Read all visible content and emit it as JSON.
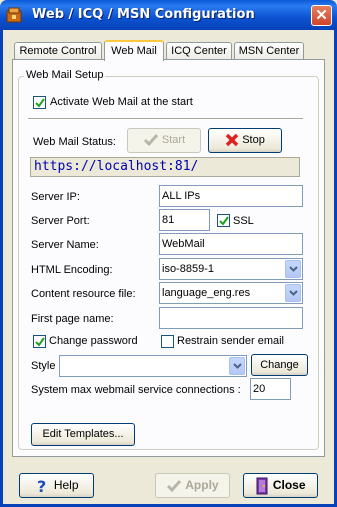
{
  "window": {
    "title": "Web / ICQ / MSN Configuration",
    "close_glyph": "✕"
  },
  "tabs": [
    {
      "label": "Remote Control",
      "active": false
    },
    {
      "label": "Web Mail",
      "active": true
    },
    {
      "label": "ICQ Center",
      "active": false
    },
    {
      "label": "MSN Center",
      "active": false
    }
  ],
  "group": {
    "title": "Web Mail Setup"
  },
  "activate": {
    "label": "Activate Web Mail at the start",
    "checked": true
  },
  "status": {
    "label": "Web Mail Status:",
    "start_label": "Start",
    "stop_label": "Stop",
    "url": "https://localhost:81/"
  },
  "fields": {
    "server_ip": {
      "label": "Server IP:",
      "value": "ALL IPs"
    },
    "server_port": {
      "label": "Server Port:",
      "value": "81"
    },
    "ssl": {
      "label": "SSL",
      "checked": true
    },
    "server_name": {
      "label": "Server Name:",
      "value": "WebMail"
    },
    "html_encoding": {
      "label": "HTML Encoding:",
      "value": "iso-8859-1"
    },
    "content_resource": {
      "label": "Content resource file:",
      "value": "language_eng.res"
    },
    "first_page": {
      "label": "First page name:",
      "value": ""
    },
    "change_password": {
      "label": "Change password",
      "checked": true
    },
    "restrain_sender": {
      "label": "Restrain sender email",
      "checked": false
    },
    "style": {
      "label": "Style",
      "value": "",
      "change_label": "Change"
    },
    "max_connections": {
      "label": "System max webmail service connections :",
      "value": "20"
    }
  },
  "edit_templates_label": "Edit Templates...",
  "footer": {
    "help_label": "Help",
    "apply_label": "Apply",
    "close_label": "Close"
  },
  "colors": {
    "titlebar": "#0842b8",
    "accent_tab": "#ffc83c",
    "stop_icon": "#e02020",
    "url_text": "#0000b0"
  },
  "icons": [
    "app-icon",
    "close-icon",
    "checkmark-icon",
    "stop-x-icon",
    "dropdown-arrow-icon",
    "help-icon",
    "close-door-icon"
  ]
}
